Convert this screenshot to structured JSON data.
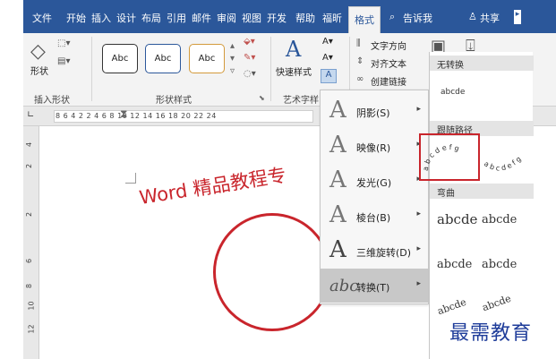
{
  "tabs": [
    "文件",
    "开始",
    "插入",
    "设计",
    "布局",
    "引用",
    "邮件",
    "审阅",
    "视图",
    "开发",
    "帮助",
    "福昕",
    "格式"
  ],
  "tell_me": "告诉我",
  "share": "共享",
  "ribbon": {
    "insert_shape_group": "插入形状",
    "shape_label": "形状",
    "shape_styles_group": "形状样式",
    "style_boxes": [
      "Abc",
      "Abc",
      "Abc"
    ],
    "quick_styles": "快速样式",
    "wordart_group": "艺术字样",
    "text_direction": "文字方向",
    "align_text": "对齐文本",
    "create_link": "创建链接"
  },
  "ruler_numbers": "8  6  4  2     2  4  6  8  10  12  14  16  18  20  22  24",
  "vruler_numbers": [
    "4",
    "2",
    "2",
    "6",
    "8",
    "10",
    "12"
  ],
  "document": {
    "wordart_text": "Word 精品教程专"
  },
  "effects_menu": [
    {
      "label": "阴影(S)",
      "icon": "A"
    },
    {
      "label": "映像(R)",
      "icon": "A"
    },
    {
      "label": "发光(G)",
      "icon": "A"
    },
    {
      "label": "棱台(B)",
      "icon": "A"
    },
    {
      "label": "三维旋转(D)",
      "icon": "A"
    },
    {
      "label": "转换(T)",
      "icon": "abc"
    }
  ],
  "gallery": {
    "no_transform": "无转换",
    "plain_sample": "abcde",
    "follow_path": "跟随路径",
    "warp": "弯曲",
    "warp_samples": [
      "abcde",
      "abcde",
      "abcde",
      "abcde"
    ]
  },
  "watermark": "最需教育",
  "colors": {
    "accent": "#2b579a",
    "wordart": "#c9252c",
    "highlight": "#c9252c",
    "watermark": "#1f3d9a"
  }
}
